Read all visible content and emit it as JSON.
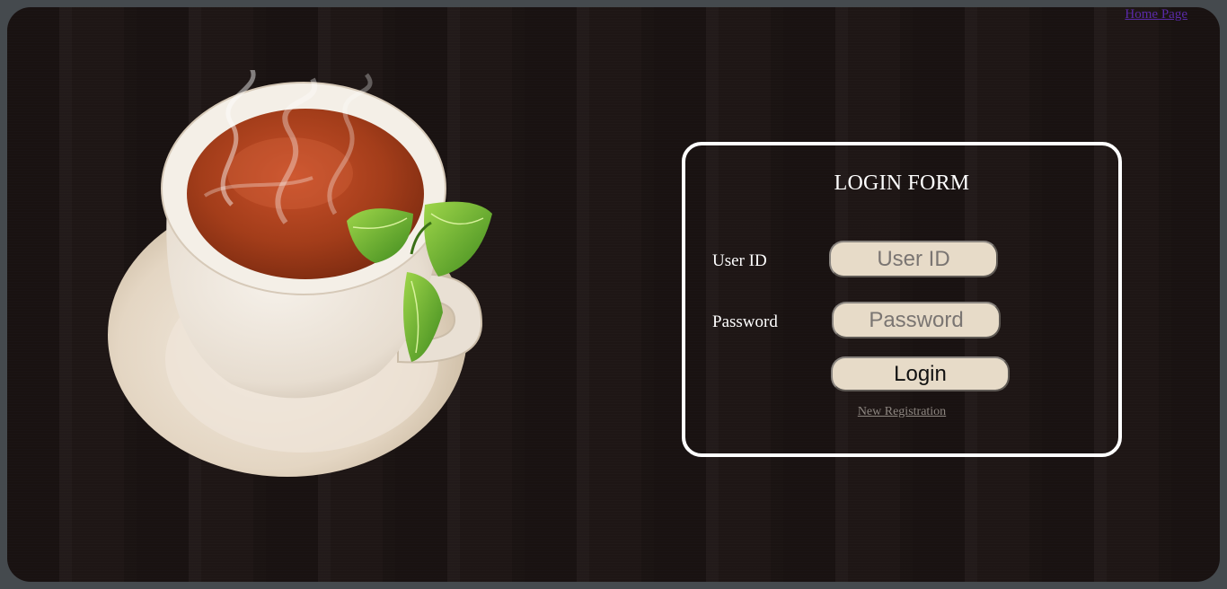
{
  "header": {
    "home_link": "Home Page"
  },
  "hero": {
    "image": "tea-cup-with-mint-illustration"
  },
  "login": {
    "title": "LOGIN FORM",
    "user_id_label": "User ID",
    "user_id_placeholder": "User ID",
    "user_id_value": "",
    "password_label": "Password",
    "password_placeholder": "Password",
    "password_value": "",
    "login_button": "Login",
    "register_link": "New Registration"
  },
  "colors": {
    "background": "#1e1615",
    "frame": "#454a4e",
    "form_border": "#ffffff",
    "input_fill": "#e7dbc8",
    "link_visited": "#5a2aa8",
    "register_link": "#8d8680"
  }
}
